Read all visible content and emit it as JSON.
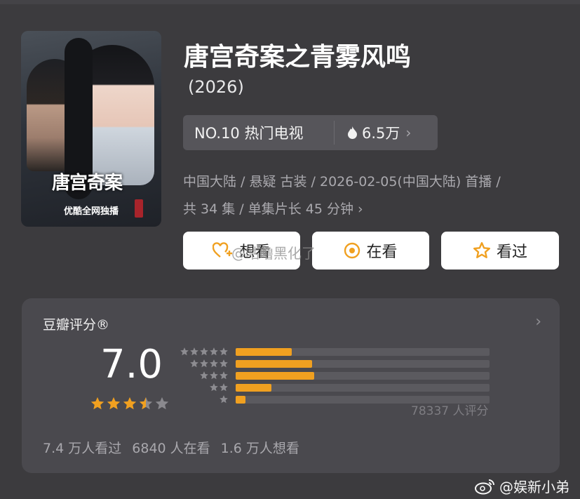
{
  "poster": {
    "title_art": "唐宫奇案",
    "subtitle": "优酷全网独播"
  },
  "show": {
    "title": "唐宫奇案之青雾风鸣",
    "year": "(2026)"
  },
  "rank": {
    "label": "NO.10 热门电视",
    "heat": "6.5万"
  },
  "meta": {
    "line1": "中国大陆 / 悬疑 古装 / 2026-02-05(中国大陆) 首播 /",
    "line2": "共 34 集 / 单集片长 45 分钟"
  },
  "actions": {
    "want": "想看",
    "watching": "在看",
    "watched": "看过"
  },
  "watermark": "@咕噜黑化了",
  "rating": {
    "title": "豆瓣评分®",
    "score": "7.0",
    "stars": 3.5,
    "distribution": [
      {
        "stars": 5,
        "fraction": 0.22
      },
      {
        "stars": 4,
        "fraction": 0.3
      },
      {
        "stars": 3,
        "fraction": 0.31
      },
      {
        "stars": 2,
        "fraction": 0.14
      },
      {
        "stars": 1,
        "fraction": 0.04
      }
    ],
    "count_label": "78337 人评分",
    "stats": [
      "7.4 万人看过",
      "6840 人在看",
      "1.6 万人想看"
    ]
  },
  "credit": "@娱新小弟",
  "colors": {
    "accent": "#f0a020",
    "panel": "#4a494e",
    "background": "#3c3b3e"
  }
}
